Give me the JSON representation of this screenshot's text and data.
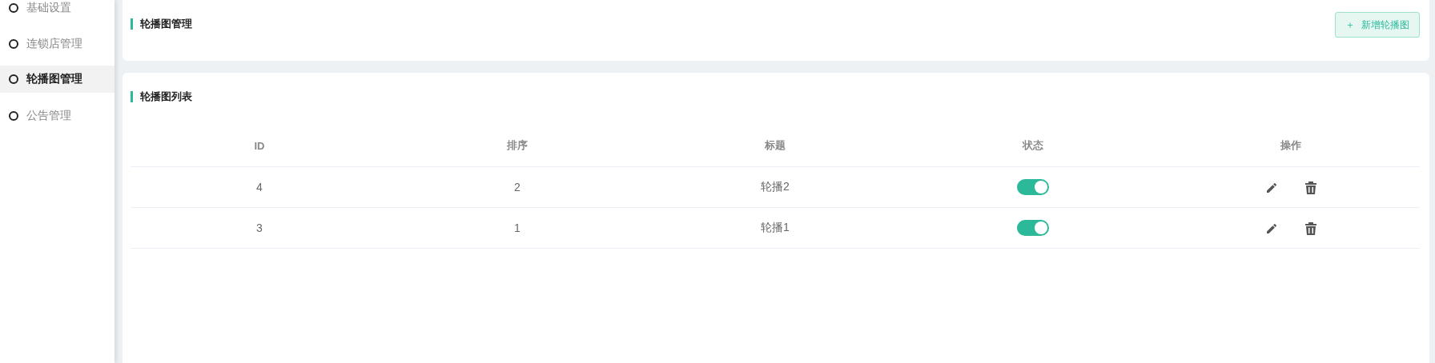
{
  "sidebar": {
    "items": [
      {
        "label": "基础设置",
        "selected": false
      },
      {
        "label": "连锁店管理",
        "selected": false
      },
      {
        "label": "轮播图管理",
        "selected": true
      },
      {
        "label": "公告管理",
        "selected": false
      }
    ]
  },
  "header_card": {
    "title": "轮播图管理",
    "add_button": {
      "icon": "＋",
      "label": "新增轮播图"
    }
  },
  "list_card": {
    "title": "轮播图列表",
    "table": {
      "columns": [
        "ID",
        "排序",
        "标题",
        "状态",
        "操作"
      ],
      "rows": [
        {
          "id": "4",
          "order": "2",
          "title": "轮播2",
          "on": true
        },
        {
          "id": "3",
          "order": "1",
          "title": "轮播1",
          "on": true
        }
      ]
    }
  }
}
